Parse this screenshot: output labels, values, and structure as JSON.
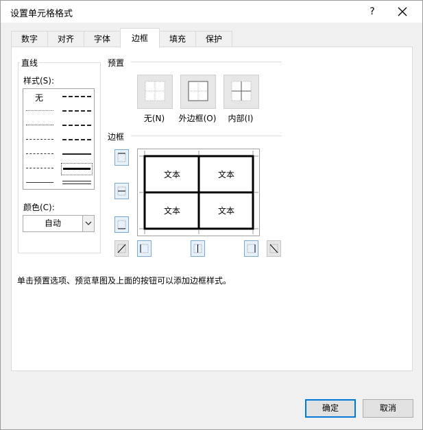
{
  "window": {
    "title": "设置单元格格式",
    "help_icon": "?",
    "close_icon": "close-icon"
  },
  "tabs": [
    {
      "label": "数字"
    },
    {
      "label": "对齐"
    },
    {
      "label": "字体"
    },
    {
      "label": "边框",
      "active": true
    },
    {
      "label": "填充"
    },
    {
      "label": "保护"
    }
  ],
  "line_group": {
    "title": "直线",
    "style_label": "样式(S):",
    "none_label": "无",
    "color_label": "颜色(C):",
    "color_value": "自动"
  },
  "presets": {
    "title": "预置",
    "items": [
      {
        "label": "无(N)"
      },
      {
        "label": "外边框(O)"
      },
      {
        "label": "内部(I)"
      }
    ]
  },
  "border": {
    "title": "边框",
    "preview_cells": [
      "文本",
      "文本",
      "文本",
      "文本"
    ]
  },
  "hint": "单击预置选项、预览草图及上面的按钮可以添加边框样式。",
  "buttons": {
    "ok": "确定",
    "cancel": "取消"
  },
  "colors": {
    "selected": "#0078d7",
    "button_bg": "#e7f1fb",
    "dialog_bg": "#f0f0f0"
  }
}
